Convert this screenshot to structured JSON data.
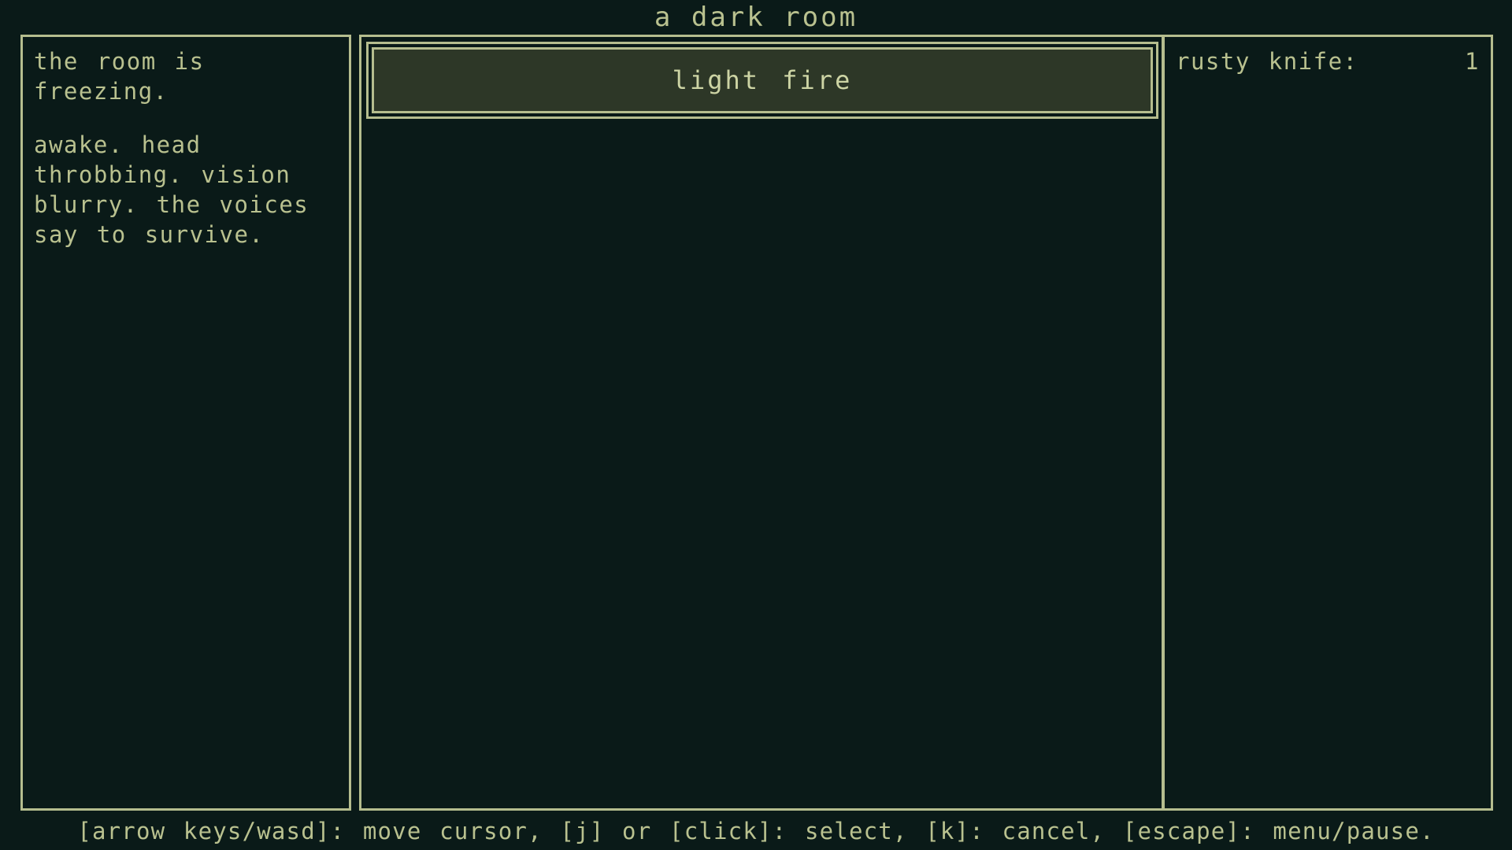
{
  "header": {
    "title": "a dark room"
  },
  "theme": {
    "background": "#0a1a18",
    "foreground": "#b9c18f",
    "border": "#b5bd8e",
    "selected_fill": "#2d3727",
    "selected_text": "#cdd4a4"
  },
  "left_panel": {
    "name": "story-log",
    "paragraphs": [
      "the room is freezing.",
      "awake. head throbbing. vision blurry. the voices say to survive."
    ]
  },
  "center_panel": {
    "name": "actions",
    "actions": [
      {
        "label": "light fire",
        "selected": true
      }
    ]
  },
  "right_panel": {
    "name": "inventory",
    "items": [
      {
        "label": "rusty knife:",
        "count": "1"
      }
    ]
  },
  "status_bar": {
    "text": "[arrow keys/wasd]: move cursor, [j] or [click]: select, [k]: cancel, [escape]: menu/pause."
  }
}
